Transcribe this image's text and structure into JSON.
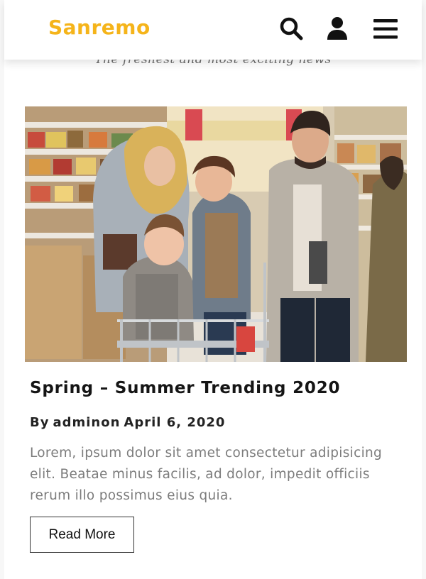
{
  "header": {
    "logo": "Sanremo",
    "logo_color": "#f5b41a",
    "icons": [
      "search-icon",
      "user-icon",
      "hamburger-menu-icon"
    ]
  },
  "tagline": "The freshest and most exciting news",
  "post": {
    "image_alt": "Family shopping with a cart in a supermarket aisle",
    "title": "Spring – Summer Trending 2020",
    "meta_prefix": "By",
    "author": "adminon",
    "date": "April 6, 2020",
    "excerpt": "Lorem, ipsum dolor sit amet consectetur adipisicing elit. Beatae minus facilis, ad dolor, impedit officiis rerum illo possimus eius quia.",
    "read_more_label": "Read More"
  }
}
